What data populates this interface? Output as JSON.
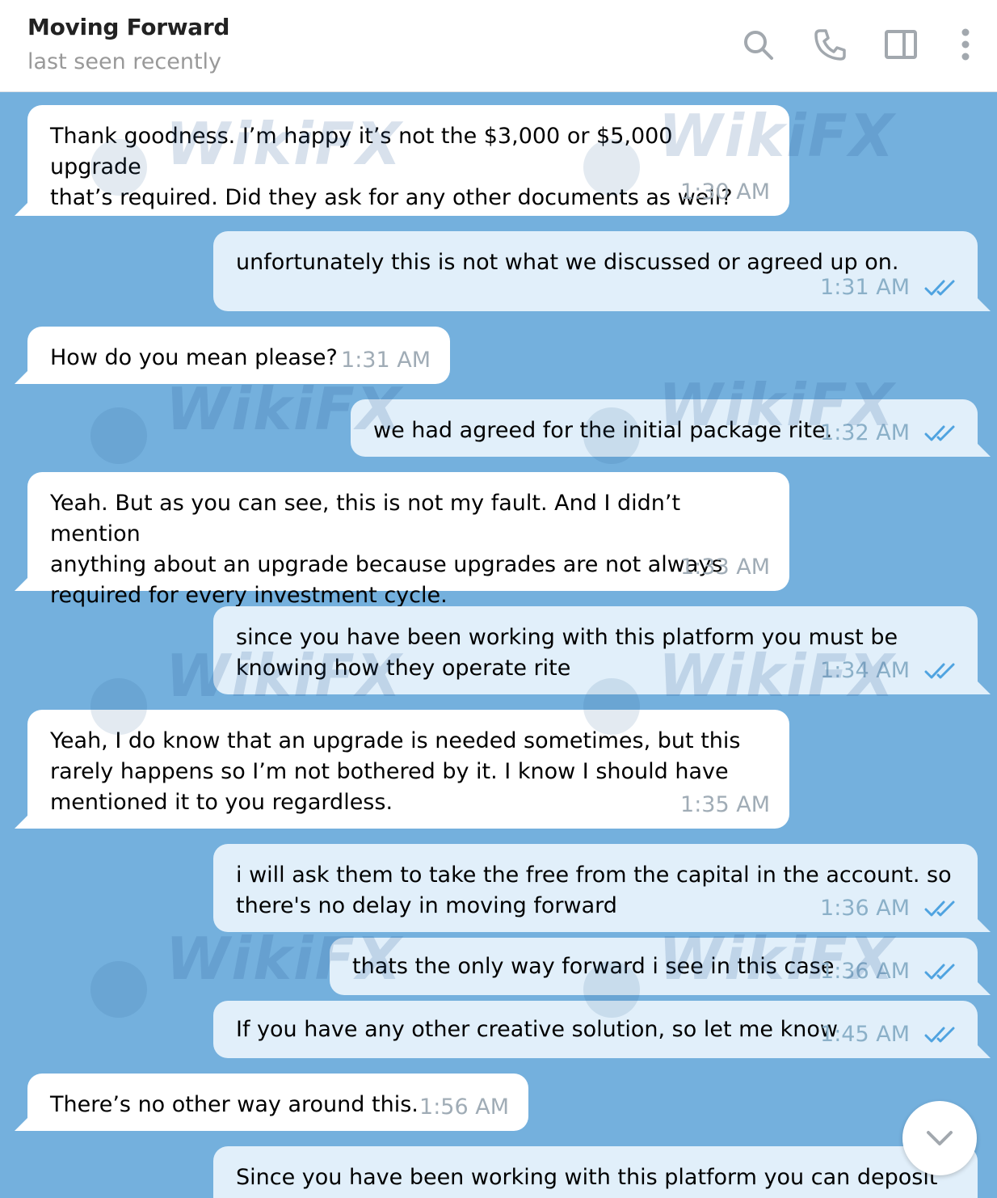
{
  "header": {
    "title": "Moving Forward",
    "status": "last seen recently"
  },
  "watermark": "WikiFX",
  "messages": [
    {
      "direction": "in",
      "text": "Thank goodness. I’m happy it’s not the $3,000 or $5,000 upgrade\nthat’s required. Did they ask for any other documents as well?",
      "time": "1:30 AM",
      "read": false
    },
    {
      "direction": "out",
      "text": "unfortunately this is not what we discussed or agreed up on.",
      "time": "1:31 AM",
      "read": true
    },
    {
      "direction": "in",
      "text": "How do you mean please?",
      "time": "1:31 AM",
      "read": false
    },
    {
      "direction": "out",
      "text": "we had agreed for the initial package rite.",
      "time": "1:32 AM",
      "read": true
    },
    {
      "direction": "in",
      "text": "Yeah. But as you can see, this is not my fault. And I didn’t mention\nanything about an upgrade because upgrades are not always\nrequired for every investment cycle.",
      "time": "1:33 AM",
      "read": false
    },
    {
      "direction": "out",
      "text": "since you have been working with this platform you must be\nknowing how they operate rite",
      "time": "1:34 AM",
      "read": true
    },
    {
      "direction": "in",
      "text": "Yeah, I do know that an upgrade is needed sometimes, but this\nrarely happens so I’m not bothered by it. I know I should have\nmentioned it to you regardless.",
      "time": "1:35 AM",
      "read": false
    },
    {
      "direction": "out",
      "text": "i will ask them to take the free from the capital in the account.  so\nthere's no delay in moving forward",
      "time": "1:36 AM",
      "read": true
    },
    {
      "direction": "out",
      "text": "thats the only way forward i see in this case",
      "time": "1:36 AM",
      "read": true
    },
    {
      "direction": "out",
      "text": "If you have any other creative solution, so let me know",
      "time": "1:45 AM",
      "read": true
    },
    {
      "direction": "in",
      "text": "There’s no other way around this.",
      "time": "1:56 AM",
      "read": false
    },
    {
      "direction": "out",
      "text": "Since you have been working with this platform you can deposit that",
      "time": "",
      "read": false
    }
  ],
  "icons": [
    "search-icon",
    "phone-icon",
    "sidebar-toggle-icon",
    "more-vertical-icon",
    "chevron-down-icon",
    "double-check-icon"
  ],
  "colors": {
    "chat_background": "#74b0dd",
    "incoming_bubble": "#ffffff",
    "outgoing_bubble": "#e1effa",
    "read_check": "#4fa3e0",
    "timestamp": "#a0acb6"
  }
}
